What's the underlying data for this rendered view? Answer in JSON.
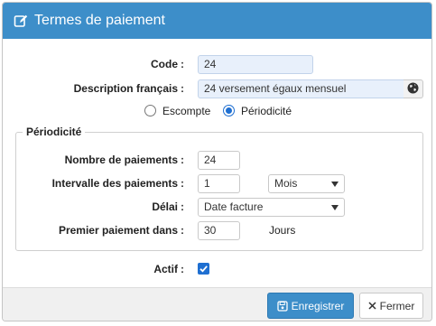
{
  "dialog": {
    "title": "Termes de paiement",
    "title_icon": "edit-icon"
  },
  "form": {
    "code": {
      "label": "Code",
      "value": "24"
    },
    "description": {
      "label": "Description français",
      "value": "24 versement égaux mensuel",
      "addon_icon": "globe-icon"
    },
    "type_radio": {
      "options": [
        {
          "label": "Escompte",
          "selected": false
        },
        {
          "label": "Périodicité",
          "selected": true
        }
      ]
    },
    "colon": ":",
    "periodicity": {
      "legend": "Périodicité",
      "nb_payments": {
        "label": "Nombre de paiements",
        "value": "24"
      },
      "interval": {
        "label": "Intervalle des paiements",
        "value": "1",
        "unit_selected": "Mois"
      },
      "delay": {
        "label": "Délai",
        "selected": "Date facture"
      },
      "first_payment": {
        "label": "Premier paiement dans",
        "value": "30",
        "unit": "Jours"
      }
    },
    "active": {
      "label": "Actif",
      "checked": true
    }
  },
  "footer": {
    "save_label": "Enregistrer",
    "save_icon": "save-icon",
    "close_label": "Fermer",
    "close_icon": "close-icon"
  },
  "colors": {
    "header": "#3d8ec9",
    "primary_button": "#3d8ec9",
    "checkbox": "#1f6fd1"
  }
}
